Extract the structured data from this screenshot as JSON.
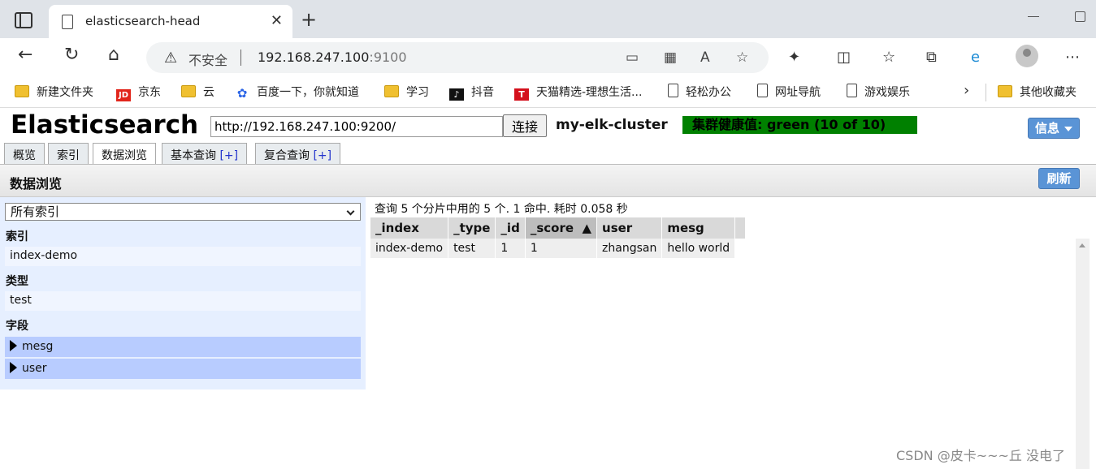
{
  "browser": {
    "tab_title": "elasticsearch-head",
    "new_tab_symbol": "+",
    "security_label": "不安全",
    "url_host": "192.168.247.100",
    "url_port": ":9100",
    "bookmarks": [
      {
        "label": "新建文件夹",
        "icon": "folder-icon"
      },
      {
        "label": "京东",
        "icon": "jd-icon"
      },
      {
        "label": "云",
        "icon": "folder-icon"
      },
      {
        "label": "百度一下，你就知道",
        "icon": "baidu-paw-icon"
      },
      {
        "label": "学习",
        "icon": "folder-icon"
      },
      {
        "label": "抖音",
        "icon": "tiktok-icon"
      },
      {
        "label": "天猫精选-理想生活...",
        "icon": "tmall-icon"
      },
      {
        "label": "轻松办公",
        "icon": "page-icon"
      },
      {
        "label": "网址导航",
        "icon": "page-icon"
      },
      {
        "label": "游戏娱乐",
        "icon": "page-icon"
      }
    ],
    "other_bookmarks": "其他收藏夹"
  },
  "header": {
    "logo": "Elasticsearch",
    "connect_url": "http://192.168.247.100:9200/",
    "connect_label": "连接",
    "cluster_name": "my-elk-cluster",
    "cluster_health": "集群健康值: green (10 of 10)",
    "info_label": "信息",
    "health_color": "#008000",
    "accent_color": "#5a94d6"
  },
  "tabs": [
    {
      "label": "概览",
      "plus": ""
    },
    {
      "label": "索引",
      "plus": ""
    },
    {
      "label": "数据浏览",
      "plus": ""
    },
    {
      "label": "基本查询",
      "plus": "[+]"
    },
    {
      "label": "复合查询",
      "plus": "[+]"
    }
  ],
  "section": {
    "title": "数据浏览",
    "refresh_label": "刷新"
  },
  "sidebar": {
    "index_select": "所有索引",
    "index_heading": "索引",
    "index_item": "index-demo",
    "type_heading": "类型",
    "type_item": "test",
    "field_heading": "字段",
    "fields": [
      "mesg",
      "user"
    ]
  },
  "results": {
    "summary": "查询 5 个分片中用的 5 个. 1 命中. 耗时 0.058 秒",
    "columns": [
      "_index",
      "_type",
      "_id",
      "_score",
      "user",
      "mesg"
    ],
    "sort_indicator": "▲",
    "rows": [
      [
        "index-demo",
        "test",
        "1",
        "1",
        "zhangsan",
        "hello world"
      ]
    ]
  },
  "watermark": "CSDN @皮卡~~~丘 没电了"
}
